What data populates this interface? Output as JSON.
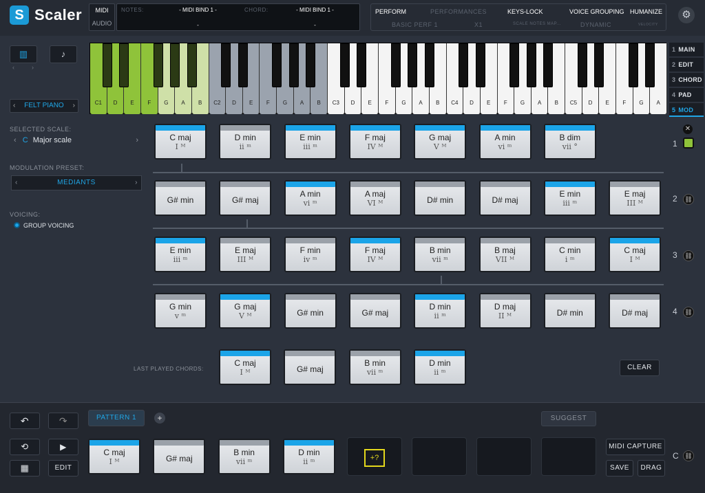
{
  "app": {
    "name": "Scaler",
    "logo_letter": "S"
  },
  "io": {
    "midi": "MIDI",
    "audio": "AUDIO"
  },
  "midi_panel": {
    "notes_label": "NOTES:",
    "notes_value": "- MIDI BIND 1 -",
    "notes_sub": "-",
    "chord_label": "CHORD:",
    "chord_value": "- MIDI BIND 1 -",
    "chord_sub": "-"
  },
  "perf": {
    "perform": "PERFORM",
    "performances": "PERFORMANCES",
    "basic": "BASIC PERF 1",
    "x1": "X1",
    "keys_lock": "KEYS-LOCK",
    "scale_notes": "SCALE NOTES MAP...",
    "voice_grouping": "VOICE GROUPING",
    "dynamic": "DYNAMIC",
    "humanize": "HUMANIZE",
    "velocity": "VELOCITY"
  },
  "instrument": "FELT PIANO",
  "keyboard": {
    "labels": [
      "C1",
      "D",
      "E",
      "F",
      "G",
      "A",
      "B",
      "C2",
      "D",
      "E",
      "F",
      "G",
      "A",
      "B",
      "C3",
      "D",
      "E",
      "F",
      "G",
      "A",
      "B",
      "C4",
      "D",
      "E",
      "F",
      "G",
      "A",
      "B",
      "C5",
      "D",
      "E",
      "F",
      "G",
      "A"
    ]
  },
  "tabs": [
    {
      "num": "1",
      "label": "MAIN"
    },
    {
      "num": "2",
      "label": "EDIT"
    },
    {
      "num": "3",
      "label": "CHORD"
    },
    {
      "num": "4",
      "label": "PAD"
    },
    {
      "num": "5",
      "label": "MOD"
    }
  ],
  "sidebar": {
    "scale_label": "SELECTED SCALE:",
    "scale_key": "C",
    "scale_name": "Major scale",
    "mod_label": "MODULATION PRESET:",
    "mod_value": "MEDIANTS",
    "voicing_label": "VOICING:",
    "voicing_value": "GROUP VOICING"
  },
  "rows": [
    {
      "num": "1",
      "chords": [
        {
          "n": "C maj",
          "d": "I ᴹ",
          "hl": true
        },
        {
          "n": "D min",
          "d": "ii ᵐ",
          "hl": false
        },
        {
          "n": "E min",
          "d": "iii ᵐ",
          "hl": true
        },
        {
          "n": "F maj",
          "d": "IV ᴹ",
          "hl": true
        },
        {
          "n": "G maj",
          "d": "V ᴹ",
          "hl": true
        },
        {
          "n": "A min",
          "d": "vi ᵐ",
          "hl": true
        },
        {
          "n": "B dim",
          "d": "vii °",
          "hl": true
        }
      ]
    },
    {
      "num": "2",
      "chords": [
        {
          "n": "G# min",
          "d": "",
          "hl": false
        },
        {
          "n": "G# maj",
          "d": "",
          "hl": false
        },
        {
          "n": "A min",
          "d": "vi ᵐ",
          "hl": true
        },
        {
          "n": "A maj",
          "d": "VI ᴹ",
          "hl": false
        },
        {
          "n": "D# min",
          "d": "",
          "hl": false
        },
        {
          "n": "D# maj",
          "d": "",
          "hl": false
        },
        {
          "n": "E min",
          "d": "iii ᵐ",
          "hl": true
        },
        {
          "n": "E maj",
          "d": "III ᴹ",
          "hl": false
        }
      ]
    },
    {
      "num": "3",
      "chords": [
        {
          "n": "E min",
          "d": "iii ᵐ",
          "hl": true
        },
        {
          "n": "E maj",
          "d": "III ᴹ",
          "hl": false
        },
        {
          "n": "F min",
          "d": "iv ᵐ",
          "hl": false
        },
        {
          "n": "F maj",
          "d": "IV ᴹ",
          "hl": true
        },
        {
          "n": "B min",
          "d": "vii ᵐ",
          "hl": false
        },
        {
          "n": "B maj",
          "d": "VII ᴹ",
          "hl": false
        },
        {
          "n": "C min",
          "d": "i ᵐ",
          "hl": false
        },
        {
          "n": "C maj",
          "d": "I ᴹ",
          "hl": true
        }
      ]
    },
    {
      "num": "4",
      "chords": [
        {
          "n": "G min",
          "d": "v ᵐ",
          "hl": false
        },
        {
          "n": "G maj",
          "d": "V ᴹ",
          "hl": true
        },
        {
          "n": "G# min",
          "d": "",
          "hl": false
        },
        {
          "n": "G# maj",
          "d": "",
          "hl": false
        },
        {
          "n": "D min",
          "d": "ii ᵐ",
          "hl": true
        },
        {
          "n": "D maj",
          "d": "II ᴹ",
          "hl": false
        },
        {
          "n": "D# min",
          "d": "",
          "hl": false
        },
        {
          "n": "D# maj",
          "d": "",
          "hl": false
        }
      ]
    }
  ],
  "last_played": {
    "label": "LAST PLAYED CHORDS:",
    "chords": [
      {
        "n": "C maj",
        "d": "I ᴹ",
        "hl": true
      },
      {
        "n": "G# maj",
        "d": "",
        "hl": false
      },
      {
        "n": "B min",
        "d": "vii ᵐ",
        "hl": false
      },
      {
        "n": "D min",
        "d": "ii ᵐ",
        "hl": true
      }
    ],
    "clear": "CLEAR"
  },
  "bottom": {
    "pattern": "PATTERN 1",
    "suggest": "SUGGEST",
    "edit": "EDIT",
    "midi_capture": "MIDI CAPTURE",
    "save": "SAVE",
    "drag": "DRAG",
    "c_label": "C",
    "chords": [
      {
        "n": "C maj",
        "d": "I ᴹ",
        "hl": true
      },
      {
        "n": "G# maj",
        "d": "",
        "hl": false
      },
      {
        "n": "B min",
        "d": "vii ᵐ",
        "hl": false
      },
      {
        "n": "D min",
        "d": "ii ᵐ",
        "hl": true
      }
    ]
  },
  "colors": {
    "accent": "#1ba4e8",
    "green_key": "#8fc33a",
    "light_green_key": "#cfe0a8",
    "grey_key": "#9ba3ae"
  }
}
